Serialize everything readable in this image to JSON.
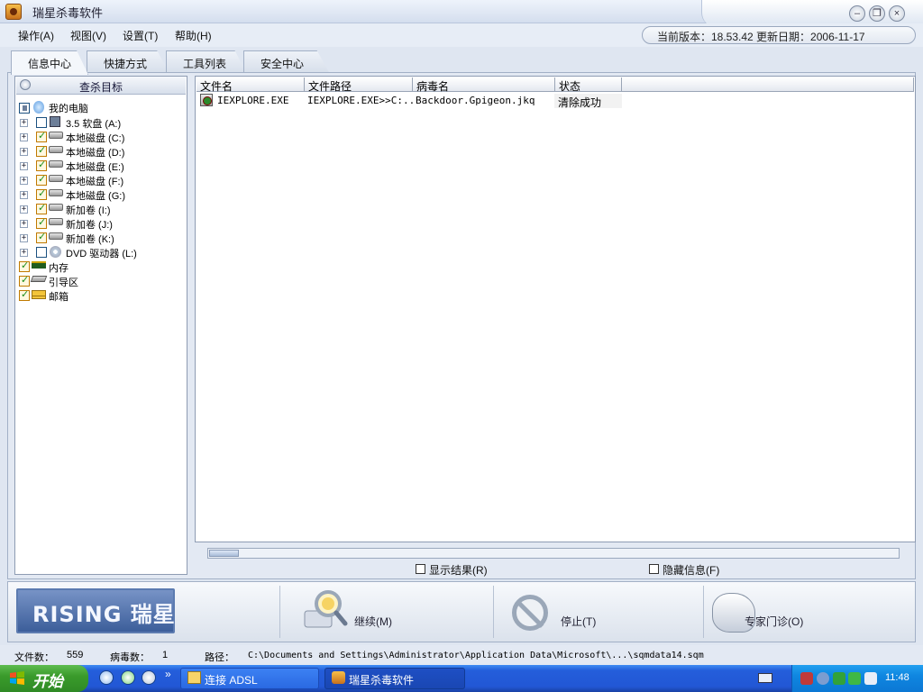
{
  "window": {
    "title": "瑞星杀毒软件"
  },
  "menu": [
    {
      "label": "操作(A)"
    },
    {
      "label": "视图(V)"
    },
    {
      "label": "设置(T)"
    },
    {
      "label": "帮助(H)"
    }
  ],
  "version": {
    "text": "当前版本：18.53.42    更新日期：2006-11-17"
  },
  "tabs": [
    {
      "label": "信息中心"
    },
    {
      "label": "快捷方式"
    },
    {
      "label": "工具列表"
    },
    {
      "label": "安全中心"
    }
  ],
  "left_panel": {
    "header": "查杀目标",
    "tree": [
      {
        "label": "我的电脑",
        "checked": "partial",
        "icon": "computer-icon"
      },
      {
        "label": "3.5 软盘 (A:)",
        "checked": false,
        "icon": "floppy-icon"
      },
      {
        "label": "本地磁盘 (C:)",
        "checked": true,
        "icon": "drive-icon"
      },
      {
        "label": "本地磁盘 (D:)",
        "checked": true,
        "icon": "drive-icon"
      },
      {
        "label": "本地磁盘 (E:)",
        "checked": true,
        "icon": "drive-icon"
      },
      {
        "label": "本地磁盘 (F:)",
        "checked": true,
        "icon": "drive-icon"
      },
      {
        "label": "本地磁盘 (G:)",
        "checked": true,
        "icon": "drive-icon"
      },
      {
        "label": "新加卷 (I:)",
        "checked": true,
        "icon": "drive-icon"
      },
      {
        "label": "新加卷 (J:)",
        "checked": true,
        "icon": "drive-icon"
      },
      {
        "label": "新加卷 (K:)",
        "checked": true,
        "icon": "drive-icon"
      },
      {
        "label": "DVD 驱动器 (L:)",
        "checked": false,
        "icon": "dvd-icon"
      },
      {
        "label": "内存",
        "checked": true,
        "icon": "memory-icon"
      },
      {
        "label": "引导区",
        "checked": true,
        "icon": "boot-sector-icon"
      },
      {
        "label": "邮箱",
        "checked": true,
        "icon": "mailbox-icon"
      }
    ]
  },
  "results": {
    "columns": [
      "文件名",
      "文件路径",
      "病毒名",
      "状态"
    ],
    "rows": [
      {
        "file": "IEXPLORE.EXE",
        "path": "IEXPLORE.EXE>>C:...",
        "virus": "Backdoor.Gpigeon.jkq",
        "status": "清除成功"
      }
    ]
  },
  "options": {
    "show_results": "显示结果(R)",
    "hide_info": "隐藏信息(F)"
  },
  "actions": {
    "logo_text": "RISING 瑞星",
    "continue": "继续(M)",
    "stop": "停止(T)",
    "expert": "专家门诊(O)"
  },
  "status": {
    "files_label": "文件数：",
    "files_value": "559",
    "virus_label": "病毒数：",
    "virus_value": "1",
    "path_label": "路径：",
    "path_value": "C:\\Documents and Settings\\Administrator\\Application Data\\Microsoft\\...\\sqmdata14.sqm"
  },
  "taskbar": {
    "start": "开始",
    "tasks": [
      {
        "label": "连接 ADSL"
      },
      {
        "label": "瑞星杀毒软件"
      }
    ],
    "clock": "11:48"
  },
  "colors": {
    "taskbar_blue": "#245edb",
    "start_green": "#3a9b2b",
    "status_success_bg": "#f2f2f2"
  }
}
